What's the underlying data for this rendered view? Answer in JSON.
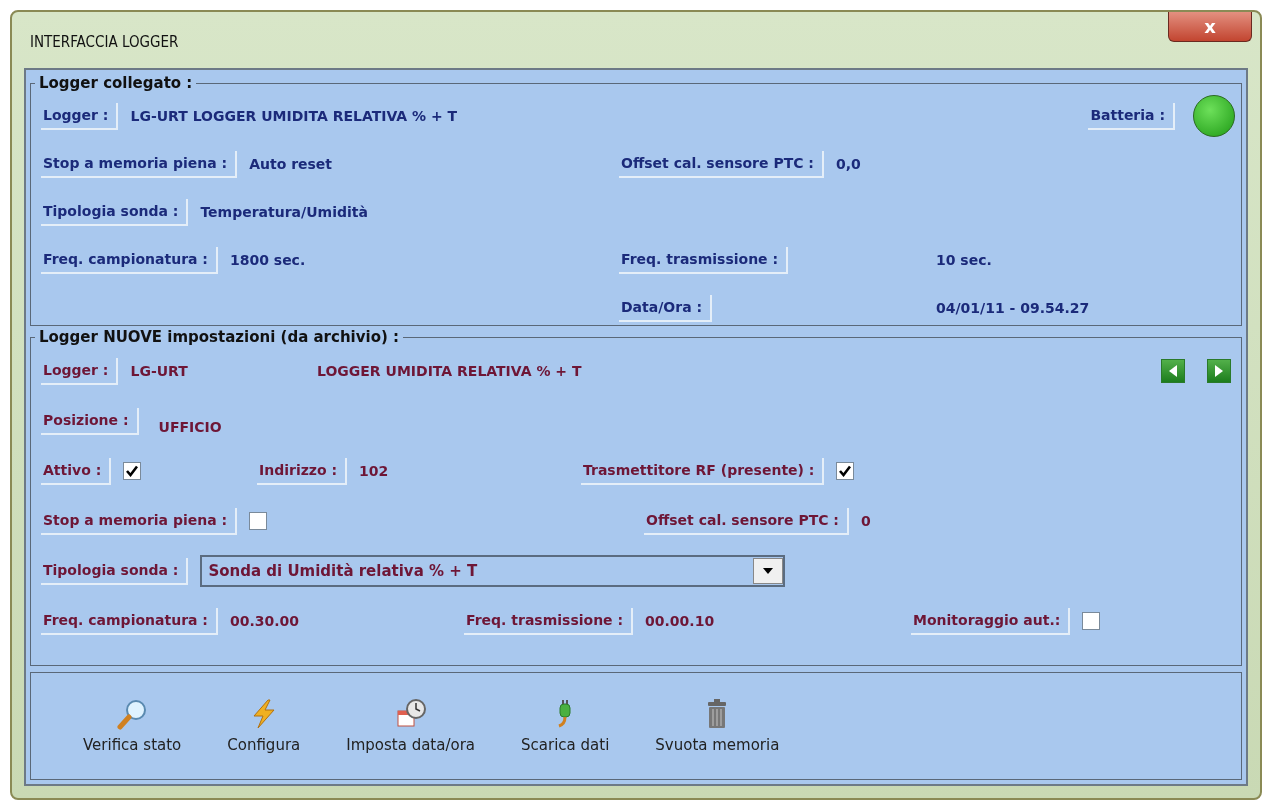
{
  "window": {
    "title": "INTERFACCIA LOGGER",
    "close": "x"
  },
  "connected": {
    "title": "Logger collegato :",
    "logger": {
      "label": "Logger :",
      "value": "LG-URT LOGGER UMIDITA RELATIVA % + T"
    },
    "battery": {
      "label": "Batteria :",
      "ok": true
    },
    "stop_full": {
      "label": "Stop a memoria piena :",
      "value": "Auto reset"
    },
    "offset": {
      "label": "Offset cal. sensore PTC :",
      "value": "0,0"
    },
    "probe": {
      "label": "Tipologia sonda :",
      "value": "Temperatura/Umidità"
    },
    "sampling": {
      "label": "Freq. campionatura :",
      "value": "1800 sec."
    },
    "transmission": {
      "label": "Freq. trasmissione :",
      "value": "10 sec."
    },
    "datetime": {
      "label": "Data/Ora :",
      "value": "04/01/11 - 09.54.27"
    }
  },
  "new_settings": {
    "title": "Logger NUOVE impostazioni (da archivio) :",
    "logger": {
      "label": "Logger :",
      "code": "LG-URT",
      "description": "LOGGER UMIDITA RELATIVA % + T"
    },
    "position": {
      "label": "Posizione :",
      "value": "UFFICIO"
    },
    "active": {
      "label": "Attivo :",
      "checked": true
    },
    "address": {
      "label": "Indirizzo :",
      "value": "102"
    },
    "rf": {
      "label": "Trasmettitore RF (presente) :",
      "checked": true
    },
    "stop_full": {
      "label": "Stop a memoria piena :",
      "checked": false
    },
    "offset": {
      "label": "Offset cal. sensore PTC :",
      "value": "0"
    },
    "probe": {
      "label": "Tipologia sonda :",
      "value": "Sonda di Umidità relativa % + T"
    },
    "sampling": {
      "label": "Freq. campionatura :",
      "value": "00.30.00"
    },
    "transmission": {
      "label": "Freq. trasmissione :",
      "value": "00.00.10"
    },
    "monitoring": {
      "label": "Monitoraggio aut.:",
      "checked": false
    }
  },
  "toolbar": [
    {
      "label": "Verifica stato",
      "kind": "search"
    },
    {
      "label": "Configura",
      "kind": "bolt"
    },
    {
      "label": "Imposta data/ora",
      "kind": "clock"
    },
    {
      "label": "Scarica dati",
      "kind": "plug"
    },
    {
      "label": "Svuota memoria",
      "kind": "trash"
    }
  ]
}
